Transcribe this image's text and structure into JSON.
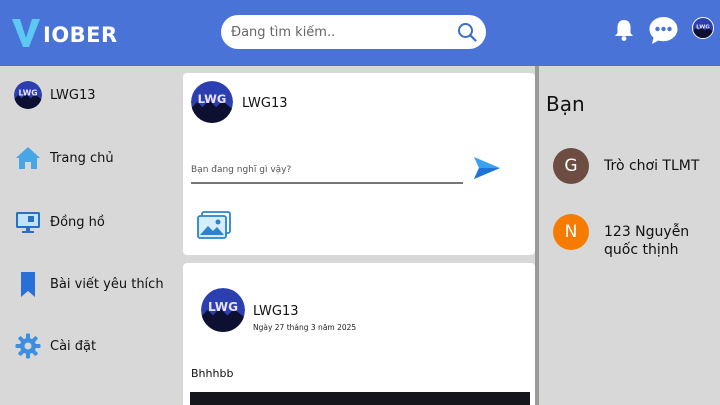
{
  "header": {
    "logo_text": "IOBER",
    "search_placeholder": "Đang tìm kiếm..",
    "icons": [
      "search-icon",
      "bell-icon",
      "chat-icon"
    ],
    "colors": {
      "bar": "#4a73d8",
      "logo_v": "#5cc8f4"
    }
  },
  "sidebar": {
    "profile_name": "LWG13",
    "items": [
      {
        "label": "Trang chủ",
        "icon": "home-icon"
      },
      {
        "label": "Đồng hồ",
        "icon": "clock-monitor-icon"
      },
      {
        "label": "Bài viết yêu thích",
        "icon": "bookmark-icon"
      },
      {
        "label": "Cài đặt",
        "icon": "gear-icon"
      }
    ]
  },
  "composer": {
    "name": "LWG13",
    "placeholder": "Bạn đang nghĩ gì vậy?",
    "icons": [
      "send-icon",
      "photo-icon"
    ]
  },
  "post": {
    "author": "LWG13",
    "date": "Ngày 27 tháng 3 năm 2025",
    "body": "Bhhhbb"
  },
  "friends": {
    "title": "Bạn",
    "list": [
      {
        "initial": "G",
        "name": "Trò chơi TLMT",
        "color": "#6d4c41"
      },
      {
        "initial": "N",
        "name": "123 Nguyễn quốc thịnh",
        "color": "#f57c00"
      }
    ]
  },
  "avatar_text": "LWG"
}
